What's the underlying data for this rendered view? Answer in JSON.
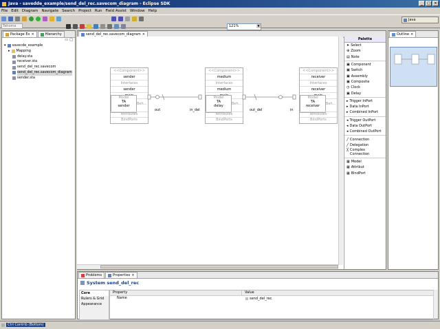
{
  "window": {
    "title": "Java - savedde_example/send_del_rec.savecom_diagram - Eclipse SDK",
    "controls": [
      "_",
      "□",
      "×"
    ]
  },
  "menu": [
    "File",
    "Edit",
    "Diagram",
    "Navigate",
    "Search",
    "Project",
    "Run",
    "Field Assist",
    "Window",
    "Help"
  ],
  "toolbar": {
    "zoom": "121%",
    "perspective": "Java",
    "font_label": "Tahoma"
  },
  "left_panel": {
    "tabs": [
      {
        "label": "Package Ex"
      },
      {
        "label": "Hierarchy"
      }
    ],
    "tree": [
      {
        "label": "savecde_example",
        "depth": 0,
        "icon": "project-icon"
      },
      {
        "label": "Mapping",
        "depth": 1,
        "icon": "folder-icon"
      },
      {
        "label": "delay.sta",
        "depth": 1,
        "icon": "file-icon"
      },
      {
        "label": "receiver.sta",
        "depth": 1,
        "icon": "file-icon"
      },
      {
        "label": "send_del_rec.savecom",
        "depth": 1,
        "icon": "file-icon"
      },
      {
        "label": "send_del_rec.savecom_diagram",
        "depth": 1,
        "icon": "diagram-file-icon",
        "selected": true
      },
      {
        "label": "sender.sta",
        "depth": 1,
        "icon": "file-icon"
      }
    ]
  },
  "editor": {
    "tab": "send_del_rec.savecom_diagram",
    "components": [
      {
        "stereotype": "<<Component>>",
        "name": "sender",
        "interfaces": "Interfaces",
        "impl": "sender",
        "main": "main",
        "model": "Model",
        "ta": "TA",
        "model_name": "sender",
        "behaviours": "Beh...",
        "attributes": "Attributes",
        "bindports": "BindPorts"
      },
      {
        "stereotype": "<<Component>>",
        "name": "medium",
        "interfaces": "Interfaces",
        "impl": "medium",
        "main": "main",
        "model": "Model",
        "ta": "TA",
        "model_name": "delay",
        "behaviours": "Beh...",
        "attributes": "Attributes",
        "bindports": "BindPorts"
      },
      {
        "stereotype": "<<Component>>",
        "name": "receiver",
        "interfaces": "Interfaces",
        "impl": "receiver",
        "main": "main",
        "model": "Model",
        "ta": "TA",
        "model_name": "receiver",
        "behaviours": "Beh...",
        "attributes": "Attributes",
        "bindports": "BindPorts"
      }
    ],
    "ports": {
      "out": "out",
      "in_del": "in_del",
      "out_del": "out_del",
      "in": "in"
    }
  },
  "palette": {
    "title": "Palette",
    "groups": [
      [
        {
          "label": "Select",
          "icon": "arrow-icon"
        },
        {
          "label": "Zoom",
          "icon": "zoom-icon"
        },
        {
          "label": "Note",
          "icon": "note-icon"
        }
      ],
      [
        {
          "label": "Component",
          "icon": "component-icon"
        },
        {
          "label": "Switch",
          "icon": "switch-icon"
        },
        {
          "label": "Assembly",
          "icon": "assembly-icon"
        },
        {
          "label": "Composite",
          "icon": "composite-icon"
        },
        {
          "label": "Clock",
          "icon": "clock-icon"
        },
        {
          "label": "Delay",
          "icon": "delay-icon"
        }
      ],
      [
        {
          "label": "Trigger InPort",
          "icon": "port-icon"
        },
        {
          "label": "Data InPort",
          "icon": "port-icon"
        },
        {
          "label": "Combined InPort",
          "icon": "port-icon"
        }
      ],
      [
        {
          "label": "Trigger OutPort",
          "icon": "port-icon"
        },
        {
          "label": "Data OutPort",
          "icon": "port-icon"
        },
        {
          "label": "Combined OutPort",
          "icon": "port-icon"
        }
      ],
      [
        {
          "label": "Connection",
          "icon": "connection-icon"
        },
        {
          "label": "Delegation",
          "icon": "delegation-icon"
        },
        {
          "label": "Complex Connection",
          "icon": "complex-icon"
        }
      ],
      [
        {
          "label": "Model",
          "icon": "model-icon"
        },
        {
          "label": "Attribut",
          "icon": "attribute-icon"
        },
        {
          "label": "BindPort",
          "icon": "bindport-icon"
        }
      ]
    ]
  },
  "outline": {
    "tab": "Outline"
  },
  "bottom": {
    "tabs": [
      {
        "label": "Problems"
      },
      {
        "label": "Properties"
      }
    ],
    "heading": "System send_del_rec",
    "side_tabs": [
      "Core",
      "Rulers & Grid",
      "Appearance"
    ],
    "columns": [
      "Property",
      "Value"
    ],
    "rows": [
      {
        "property": "Name",
        "value": "send_del_rec"
      }
    ]
  },
  "status": {
    "item": "Ctrl Contrib (Bottom)"
  }
}
